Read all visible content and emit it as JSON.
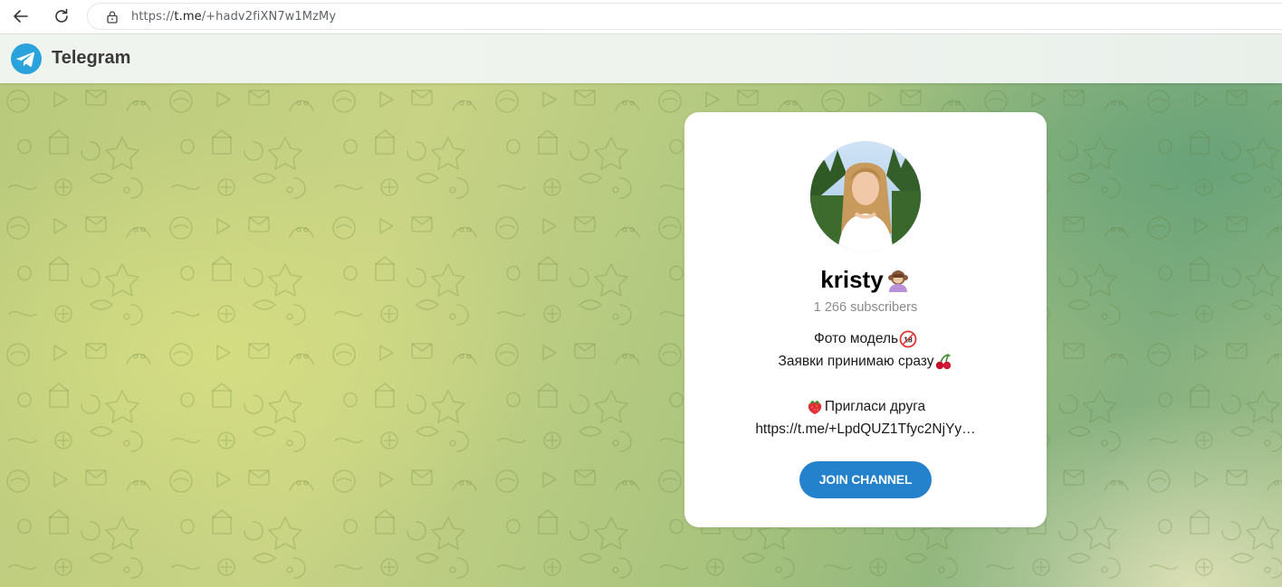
{
  "browser": {
    "url_prefix": "https://",
    "url_host": "t.me",
    "url_path": "/+hadv2fiXN7w1MzMy"
  },
  "header": {
    "brand": "Telegram"
  },
  "channel": {
    "title": "kristy",
    "subscribers": "1 266 subscribers",
    "description_line1": "Фото модель",
    "description_line2": "Заявки принимаю сразу",
    "description_line3": "Пригласи друга",
    "description_line4": "https://t.me/+LpdQUZ1Tfyc2NjYy…",
    "join_label": "JOIN CHANNEL"
  },
  "colors": {
    "accent": "#2481cc",
    "logo": "#2aa3dd"
  },
  "icons": [
    "back-arrow-icon",
    "reload-icon",
    "lock-icon",
    "telegram-logo-icon",
    "monkey-emoji-icon",
    "18-plus-emoji-icon",
    "cherries-emoji-icon",
    "strawberry-emoji-icon"
  ]
}
